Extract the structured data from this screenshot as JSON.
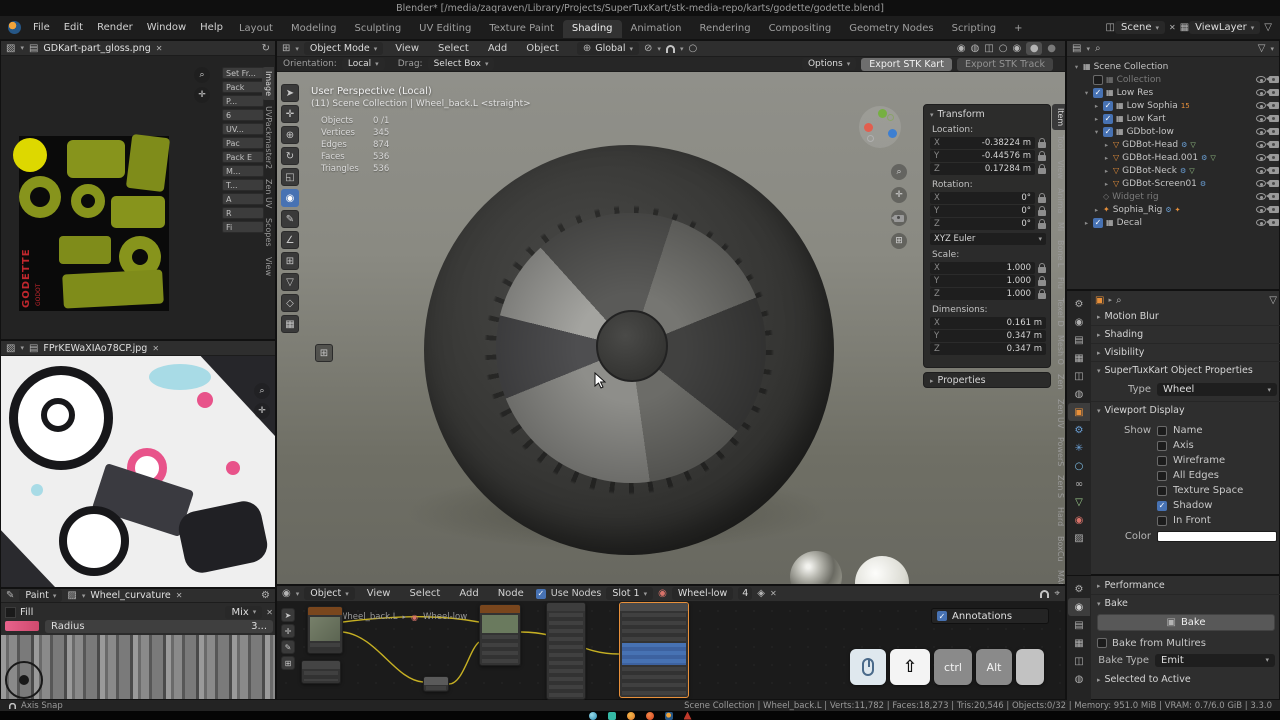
{
  "colors": {
    "accent": "#4772b3",
    "object_orange": "#e8903a",
    "wire_yellow": "#c6b023"
  },
  "glyphs": {
    "caret": "▾",
    "tri_right": "▸",
    "tri_down": "▾",
    "close": "✕",
    "plus": "+",
    "search": "⌕",
    "grid": "⊞",
    "globe": "⊕",
    "slash": "⊘",
    "circle": "◉",
    "ring": "○",
    "dot": "●",
    "square": "▣",
    "sq_grid": "▦",
    "sq_half": "◫",
    "sq_lines": "▤",
    "sq_hatch": "▨",
    "world": "◍",
    "gear": "⚙",
    "pencil": "✎",
    "cursor": "➤",
    "cross": "✛",
    "rotate": "↻",
    "scale": "◱",
    "angle": "∠",
    "asterisk": "✳",
    "infinity": "∞",
    "tri_sm": "▽",
    "pin": "⌖",
    "star4": "✦",
    "diamond_o": "◇",
    "shield": "◈"
  },
  "titlebar": {
    "title": "Blender* [/media/zaqraven/Library/Projects/SuperTuxKart/stk-media-repo/karts/godette/godette.blend]"
  },
  "topbar": {
    "menus": [
      "File",
      "Edit",
      "Render",
      "Window",
      "Help"
    ],
    "tabs": [
      "Layout",
      "Modeling",
      "Sculpting",
      "UV Editing",
      "Texture Paint",
      "Shading",
      "Animation",
      "Rendering",
      "Compositing",
      "Geometry Nodes",
      "Scripting"
    ],
    "add_tab": "+",
    "scene": {
      "label": "Scene"
    },
    "view_layer": {
      "label": "ViewLayer"
    }
  },
  "uv_editor": {
    "filename": "GDKart-part_gloss.png",
    "panel_buttons": [
      "Set Fr...",
      "Pack",
      "P...",
      "6",
      "UV...",
      "Pac",
      "Pack E",
      "M...",
      "T...",
      "A",
      "R",
      "Fi"
    ],
    "vertical_tabs": [
      "Image",
      "UVPackmaster2",
      "Zen UV",
      "Scopes",
      "View"
    ],
    "logo_text": "GODETTE",
    "logo_sub": "GODOT"
  },
  "ref_editor": {
    "filename": "FPrKEWaXIAo78CP.jpg"
  },
  "paint_editor": {
    "mode": "Paint",
    "texture": "Wheel_curvature",
    "brush": "Fill",
    "blend": "Mix",
    "radius_label": "Radius",
    "radius_value": "3..."
  },
  "viewport": {
    "header": {
      "mode": "Object Mode",
      "menus": [
        "View",
        "Select",
        "Add",
        "Object"
      ],
      "orientation": "Global"
    },
    "tools_row": {
      "orientation_label": "Orientation:",
      "orientation_value": "Local",
      "drag_label": "Drag:",
      "drag_value": "Select Box",
      "options": "Options",
      "export_kart": "Export STK Kart",
      "export_track": "Export STK Track"
    },
    "overlay": {
      "view": "User Perspective (Local)",
      "context": "(11) Scene Collection | Wheel_back.L <straight>",
      "stats": [
        {
          "label": "Objects",
          "value": "0 /1"
        },
        {
          "label": "Vertices",
          "value": "345"
        },
        {
          "label": "Edges",
          "value": "874"
        },
        {
          "label": "Faces",
          "value": "536"
        },
        {
          "label": "Triangles",
          "value": "536"
        }
      ]
    },
    "npanel": {
      "transform_title": "Transform",
      "location_label": "Location:",
      "loc": [
        {
          "axis": "X",
          "value": "-0.38224 m"
        },
        {
          "axis": "Y",
          "value": "-0.44576 m"
        },
        {
          "axis": "Z",
          "value": "0.17284 m"
        }
      ],
      "rotation_label": "Rotation:",
      "rot": [
        {
          "axis": "X",
          "value": "0°"
        },
        {
          "axis": "Y",
          "value": "0°"
        },
        {
          "axis": "Z",
          "value": "0°"
        }
      ],
      "euler": "XYZ Euler",
      "scale_label": "Scale:",
      "scl": [
        {
          "axis": "X",
          "value": "1.000"
        },
        {
          "axis": "Y",
          "value": "1.000"
        },
        {
          "axis": "Z",
          "value": "1.000"
        }
      ],
      "dims_label": "Dimensions:",
      "dim": [
        {
          "axis": "X",
          "value": "0.161 m"
        },
        {
          "axis": "Y",
          "value": "0.347 m"
        },
        {
          "axis": "Z",
          "value": "0.347 m"
        }
      ],
      "properties_title": "Properties"
    },
    "side_tabs": [
      "Item",
      "Tool",
      "View",
      "Anima",
      "Mi",
      "Bone L",
      "Flu",
      "Texel D",
      "Mesh O",
      "Zen",
      "Zen UV",
      "PowerS",
      "Zen S",
      "Hard",
      "BoxCu",
      "MACH"
    ]
  },
  "outliner": {
    "rows": [
      {
        "label": "Scene Collection"
      },
      {
        "label": "Collection"
      },
      {
        "label": "Low Res"
      },
      {
        "label": "Low Sophia",
        "badge": "15"
      },
      {
        "label": "Low Kart"
      },
      {
        "label": "GDbot-low"
      },
      {
        "label": "GDBot-Head"
      },
      {
        "label": "GDBot-Head.001"
      },
      {
        "label": "GDBot-Neck"
      },
      {
        "label": "GDBot-Screen01"
      },
      {
        "label": "Widget rig"
      },
      {
        "label": "Sophia_Rig"
      },
      {
        "label": "Decal"
      }
    ]
  },
  "props_object": {
    "panel_motion_blur": "Motion Blur",
    "panel_shading": "Shading",
    "panel_visibility": "Visibility",
    "panel_stk": "SuperTuxKart Object Properties",
    "type_label": "Type",
    "type_value": "Wheel",
    "panel_viewport_display": "Viewport Display",
    "show_label": "Show",
    "options": [
      {
        "label": "Name",
        "checked": false
      },
      {
        "label": "Axis",
        "checked": false
      },
      {
        "label": "Wireframe",
        "checked": false
      },
      {
        "label": "All Edges",
        "checked": false
      },
      {
        "label": "Texture Space",
        "checked": false
      },
      {
        "label": "Shadow",
        "checked": true
      },
      {
        "label": "In Front",
        "checked": false
      }
    ],
    "color_label": "Color"
  },
  "props_render": {
    "panel_performance": "Performance",
    "panel_bake": "Bake",
    "bake_button": "Bake",
    "multires": "Bake from Multires",
    "bake_type_label": "Bake Type",
    "bake_type_value": "Emit",
    "selected_to_active": "Selected to Active"
  },
  "shader_editor": {
    "mode": "Object",
    "menus": [
      "View",
      "Select",
      "Add",
      "Node"
    ],
    "use_nodes": "Use Nodes",
    "slot": "Slot 1",
    "material": "Wheel-low",
    "users": "4",
    "breadcrumb_parent": "Wheel_back.L",
    "breadcrumb_child": "Wheel-low",
    "annotations": "Annotations",
    "keys": {
      "shift": "⇧",
      "ctrl": "ctrl",
      "alt": "Alt"
    }
  },
  "statusbar": {
    "left": "Axis Snap",
    "right": "Scene Collection | Wheel_back.L | Verts:11,782 | Faces:18,273 | Tris:20,546 | Objects:0/32 | Memory: 951.0 MiB | VRAM: 0.7/6.0 GiB | 3.3.0"
  }
}
